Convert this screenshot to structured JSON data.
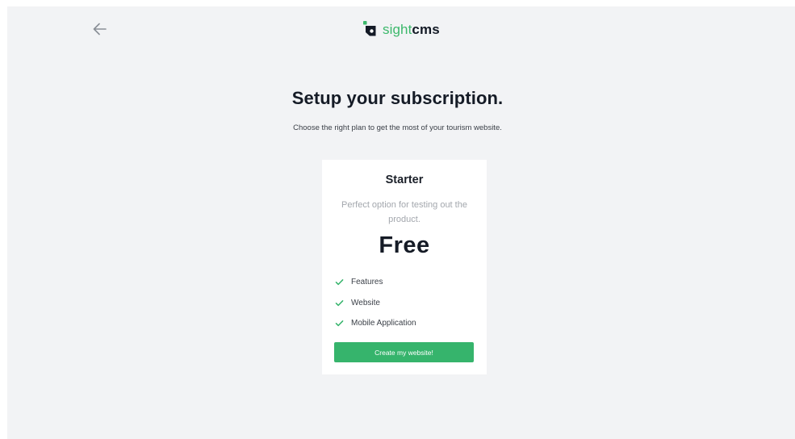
{
  "header": {
    "back_icon": "arrow-left-icon",
    "logo": {
      "icon": "sightcms-logo-icon",
      "word_light": "sight",
      "word_bold": "cms",
      "brand_color": "#3cb86b"
    }
  },
  "main": {
    "title": "Setup your subscription.",
    "subtitle": "Choose the right plan to get the most of your tourism website."
  },
  "plan": {
    "name": "Starter",
    "description": "Perfect option for testing out the product.",
    "price": "Free",
    "features": [
      {
        "label": "Features",
        "icon": "check-icon"
      },
      {
        "label": "Website",
        "icon": "check-icon"
      },
      {
        "label": "Mobile Application",
        "icon": "check-icon"
      }
    ],
    "cta_label": "Create my website!",
    "accent_color": "#36b46c"
  }
}
